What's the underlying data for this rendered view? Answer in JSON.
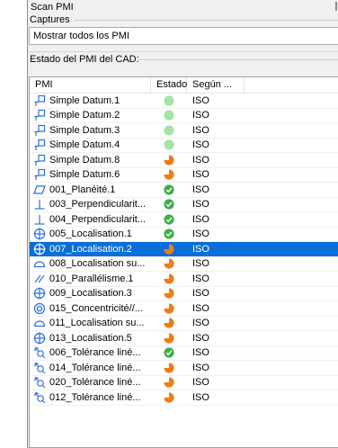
{
  "panel": {
    "title": "Scan PMI"
  },
  "captures": {
    "label": "Captures",
    "value": "Mostrar todos los PMI"
  },
  "status_group": {
    "label": "Estado del PMI del CAD:"
  },
  "table": {
    "headers": [
      "PMI",
      "Estado",
      "Según ..."
    ],
    "rows": [
      {
        "name": "Simple Datum.1",
        "icon": "datum-icon",
        "status": "light-green",
        "standard": "ISO"
      },
      {
        "name": "Simple Datum.2",
        "icon": "datum-icon",
        "status": "light-green",
        "standard": "ISO"
      },
      {
        "name": "Simple Datum.3",
        "icon": "datum-icon",
        "status": "light-green",
        "standard": "ISO"
      },
      {
        "name": "Simple Datum.4",
        "icon": "datum-icon",
        "status": "light-green",
        "standard": "ISO"
      },
      {
        "name": "Simple Datum.8",
        "icon": "datum-icon",
        "status": "orange",
        "standard": "ISO"
      },
      {
        "name": "Simple Datum.6",
        "icon": "datum-icon",
        "status": "orange",
        "standard": "ISO"
      },
      {
        "name": "001_Planéité.1",
        "icon": "flatness-icon",
        "status": "green-check",
        "standard": "ISO"
      },
      {
        "name": "003_Perpendicularit...",
        "icon": "perpendicularity-icon",
        "status": "green-check",
        "standard": "ISO"
      },
      {
        "name": "004_Perpendicularit...",
        "icon": "perpendicularity-icon",
        "status": "green-check",
        "standard": "ISO"
      },
      {
        "name": "005_Localisation.1",
        "icon": "position-icon",
        "status": "green-check",
        "standard": "ISO"
      },
      {
        "name": "007_Localisation.2",
        "icon": "position-icon",
        "status": "orange",
        "standard": "ISO",
        "selected": true
      },
      {
        "name": "008_Localisation su...",
        "icon": "surface-profile-icon",
        "status": "orange",
        "standard": "ISO"
      },
      {
        "name": "010_Parallélisme.1",
        "icon": "parallelism-icon",
        "status": "orange",
        "standard": "ISO"
      },
      {
        "name": "009_Localisation.3",
        "icon": "position-icon",
        "status": "orange",
        "standard": "ISO"
      },
      {
        "name": "015_Concentricité//...",
        "icon": "concentricity-icon",
        "status": "orange",
        "standard": "ISO"
      },
      {
        "name": "011_Localisation su...",
        "icon": "surface-profile-icon",
        "status": "orange",
        "standard": "ISO"
      },
      {
        "name": "013_Localisation.5",
        "icon": "position-icon",
        "status": "orange",
        "standard": "ISO"
      },
      {
        "name": "006_Tolérance liné...",
        "icon": "linear-tolerance-icon",
        "status": "green-check",
        "standard": "ISO"
      },
      {
        "name": "014_Tolérance liné...",
        "icon": "linear-tolerance-icon",
        "status": "orange",
        "standard": "ISO"
      },
      {
        "name": "020_Tolérance liné...",
        "icon": "linear-tolerance-icon",
        "status": "orange",
        "standard": "ISO"
      },
      {
        "name": "012_Tolérance liné...",
        "icon": "linear-tolerance-icon",
        "status": "orange",
        "standard": "ISO"
      }
    ]
  },
  "colors": {
    "selection": "#0a6ed8",
    "icon_blue": "#2f6fd6",
    "status_light_green": "#a8e2a6",
    "status_green": "#3fae49",
    "status_orange": "#f07c16"
  }
}
